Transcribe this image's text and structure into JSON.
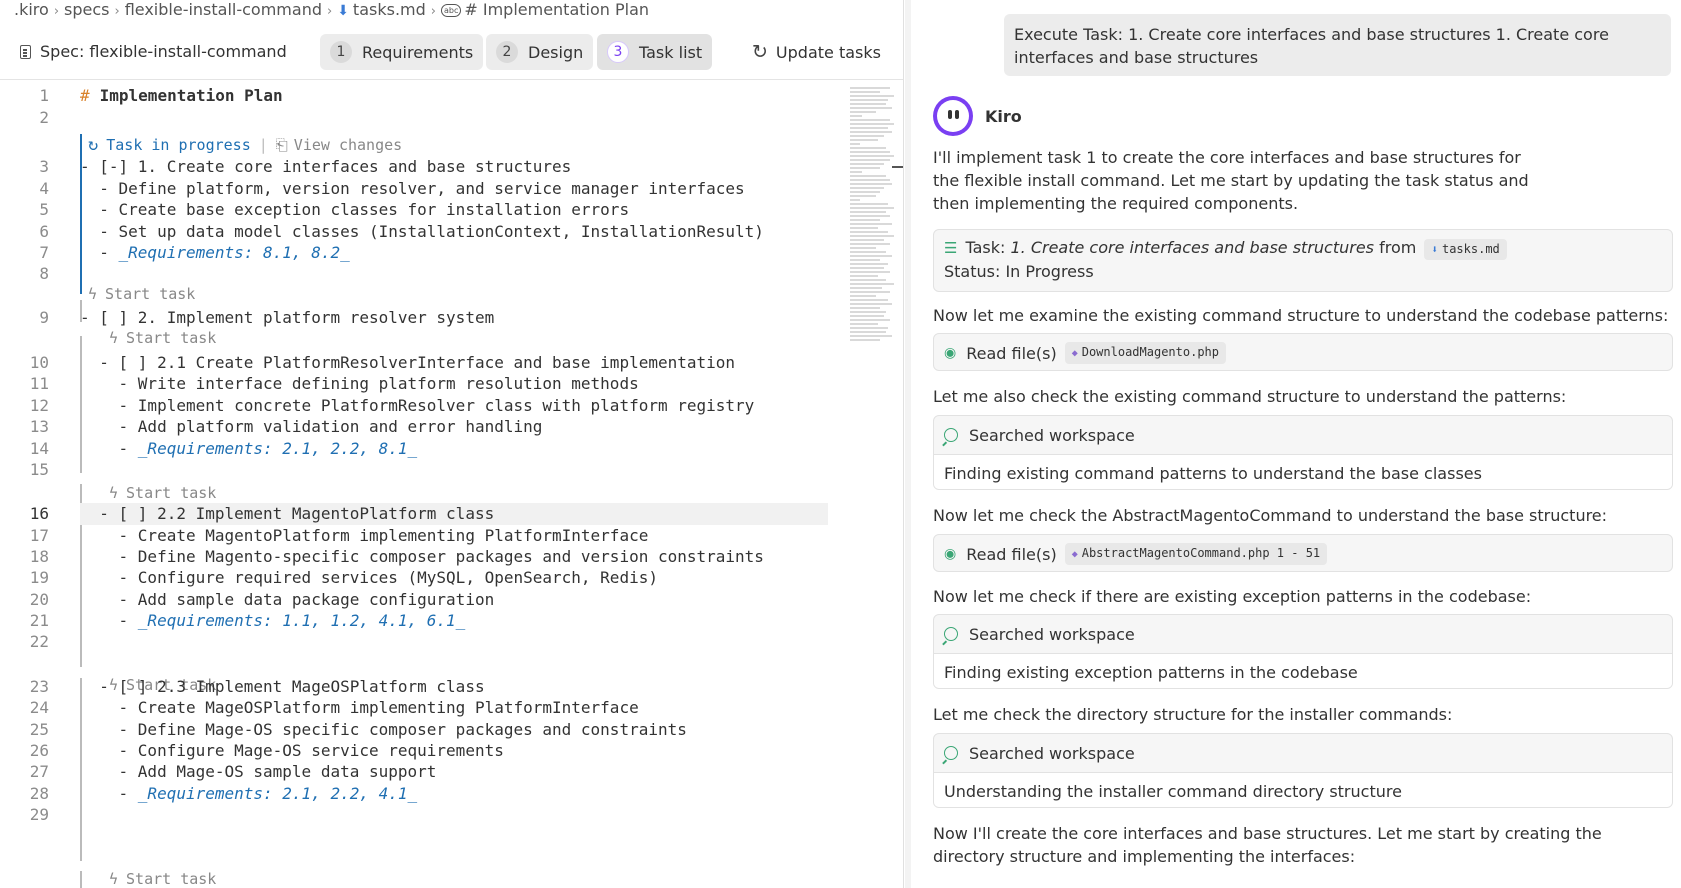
{
  "breadcrumb": {
    "items": [
      ".kiro",
      "specs",
      "flexible-install-command",
      "tasks.md",
      "# Implementation Plan"
    ]
  },
  "spec": {
    "title": "Spec: flexible-install-command",
    "tabs": [
      {
        "num": "1",
        "label": "Requirements"
      },
      {
        "num": "2",
        "label": "Design"
      },
      {
        "num": "3",
        "label": "Task list"
      }
    ],
    "active_tab": "Task list",
    "update_label": "Update tasks"
  },
  "editor": {
    "codelens_in_progress": "Task in progress",
    "codelens_separator": "|",
    "codelens_view_changes": "View changes",
    "codelens_start": "Start task",
    "lines": [
      {
        "n": "1",
        "hash": "#",
        "text": "Implementation Plan"
      },
      {
        "n": "2",
        "text": ""
      },
      {
        "n": "3",
        "text": "- [-] 1. Create core interfaces and base structures"
      },
      {
        "n": "4",
        "text": "  - Define platform, version resolver, and service manager interfaces"
      },
      {
        "n": "5",
        "text": "  - Create base exception classes for installation errors"
      },
      {
        "n": "6",
        "text": "  - Set up data model classes (InstallationContext, InstallationResult)"
      },
      {
        "n": "7",
        "prefix": "  - ",
        "req": "_Requirements: 8.1, 8.2_"
      },
      {
        "n": "8",
        "text": ""
      },
      {
        "n": "9",
        "text": "- [ ] 2. Implement platform resolver system"
      },
      {
        "n": "10",
        "text": "  - [ ] 2.1 Create PlatformResolverInterface and base implementation"
      },
      {
        "n": "11",
        "text": "    - Write interface defining platform resolution methods"
      },
      {
        "n": "12",
        "text": "    - Implement concrete PlatformResolver class with platform registry"
      },
      {
        "n": "13",
        "text": "    - Add platform validation and error handling"
      },
      {
        "n": "14",
        "prefix": "    - ",
        "req": "_Requirements: 2.1, 2.2, 8.1_"
      },
      {
        "n": "15",
        "text": ""
      },
      {
        "n": "16",
        "text": "  - [ ] 2.2 Implement MagentoPlatform class"
      },
      {
        "n": "17",
        "text": "    - Create MagentoPlatform implementing PlatformInterface"
      },
      {
        "n": "18",
        "text": "    - Define Magento-specific composer packages and version constraints"
      },
      {
        "n": "19",
        "text": "    - Configure required services (MySQL, OpenSearch, Redis)"
      },
      {
        "n": "20",
        "text": "    - Add sample data package configuration"
      },
      {
        "n": "21",
        "prefix": "    - ",
        "req": "_Requirements: 1.1, 1.2, 4.1, 6.1_"
      },
      {
        "n": "22",
        "text": ""
      },
      {
        "n": "23",
        "text": "  - [ ] 2.3 Implement MageOSPlatform class"
      },
      {
        "n": "24",
        "text": "    - Create MageOSPlatform implementing PlatformInterface"
      },
      {
        "n": "25",
        "text": "    - Define Mage-OS specific composer packages and constraints"
      },
      {
        "n": "26",
        "text": "    - Configure Mage-OS service requirements"
      },
      {
        "n": "27",
        "text": "    - Add Mage-OS sample data support"
      },
      {
        "n": "28",
        "prefix": "    - ",
        "req": "_Requirements: 2.1, 2.2, 4.1_"
      },
      {
        "n": "29",
        "text": ""
      }
    ]
  },
  "chat": {
    "user_message": "Execute Task: 1. Create core interfaces and base structures 1. Create core interfaces and base structures",
    "assistant_name": "Kiro",
    "intro": "I'll implement task 1 to create the core interfaces and base structures for the flexible install command. Let me start by updating the task status and then implementing the required components.",
    "task_card": {
      "prefix": "Task:",
      "task_title": "1. Create core interfaces and base structures",
      "from_label": "from",
      "file": "tasks.md",
      "status": "Status: In Progress"
    },
    "messages": [
      {
        "text": "Now let me examine the existing command structure to understand the codebase patterns:"
      },
      {
        "tool": "Read file(s)",
        "file": "DownloadMagento.php"
      },
      {
        "text": "Let me also check the existing command structure to understand the patterns:"
      },
      {
        "tool": "Searched workspace",
        "detail": "Finding existing command patterns to understand the base classes"
      },
      {
        "text": "Now let me check the AbstractMagentoCommand to understand the base structure:"
      },
      {
        "tool": "Read file(s)",
        "file": "AbstractMagentoCommand.php 1 - 51"
      },
      {
        "text": "Now let me check if there are existing exception patterns in the codebase:"
      },
      {
        "tool": "Searched workspace",
        "detail": "Finding existing exception patterns in the codebase"
      },
      {
        "text": "Let me check the directory structure for the installer commands:"
      },
      {
        "tool": "Searched workspace",
        "detail": "Understanding the installer command directory structure"
      },
      {
        "text": "Now I'll create the core interfaces and base structures. Let me start by creating the directory structure and implementing the interfaces:"
      }
    ]
  },
  "colors": {
    "accent": "#7a3ff2",
    "link_blue": "#1f6fb2",
    "heading_hash": "#d9822b",
    "tool_green": "#3aa675"
  }
}
